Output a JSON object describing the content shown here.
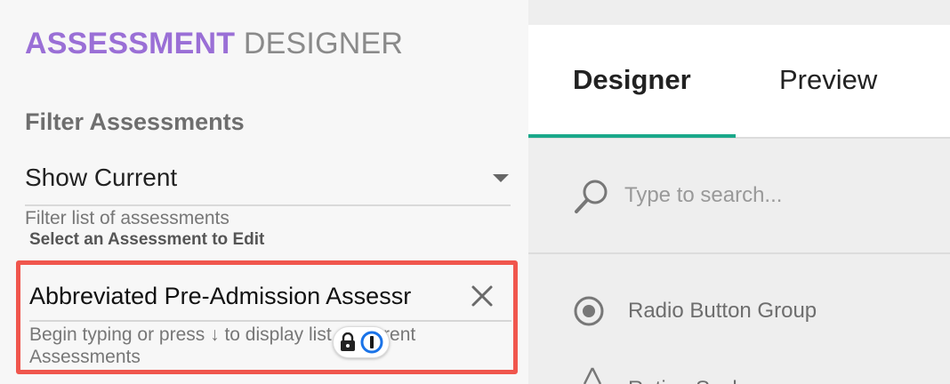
{
  "header": {
    "title_accent": "ASSESSMENT",
    "title_rest": "DESIGNER"
  },
  "filter": {
    "heading": "Filter Assessments",
    "selected": "Show Current",
    "helper": "Filter list of assessments"
  },
  "assessment_select": {
    "label": "Select an Assessment to Edit",
    "value": "Abbreviated Pre-Admission Assessr",
    "helper": "Begin typing or press ↓ to display list of current Assessments"
  },
  "tabs": [
    {
      "label": "Designer",
      "active": true
    },
    {
      "label": "Preview",
      "active": false
    }
  ],
  "search": {
    "placeholder": "Type to search..."
  },
  "components": [
    {
      "label": "Radio Button Group",
      "icon": "radio-button-icon"
    },
    {
      "label": "Rating Scale",
      "icon": "rating-scale-icon"
    }
  ],
  "colors": {
    "accent": "#9a6fd6",
    "tab_indicator": "#1aa88a",
    "highlight": "#f0564d"
  },
  "icons": [
    "chevron-down-icon",
    "close-icon",
    "lock-icon",
    "password-manager-icon",
    "search-icon",
    "radio-button-icon",
    "rating-scale-icon"
  ]
}
